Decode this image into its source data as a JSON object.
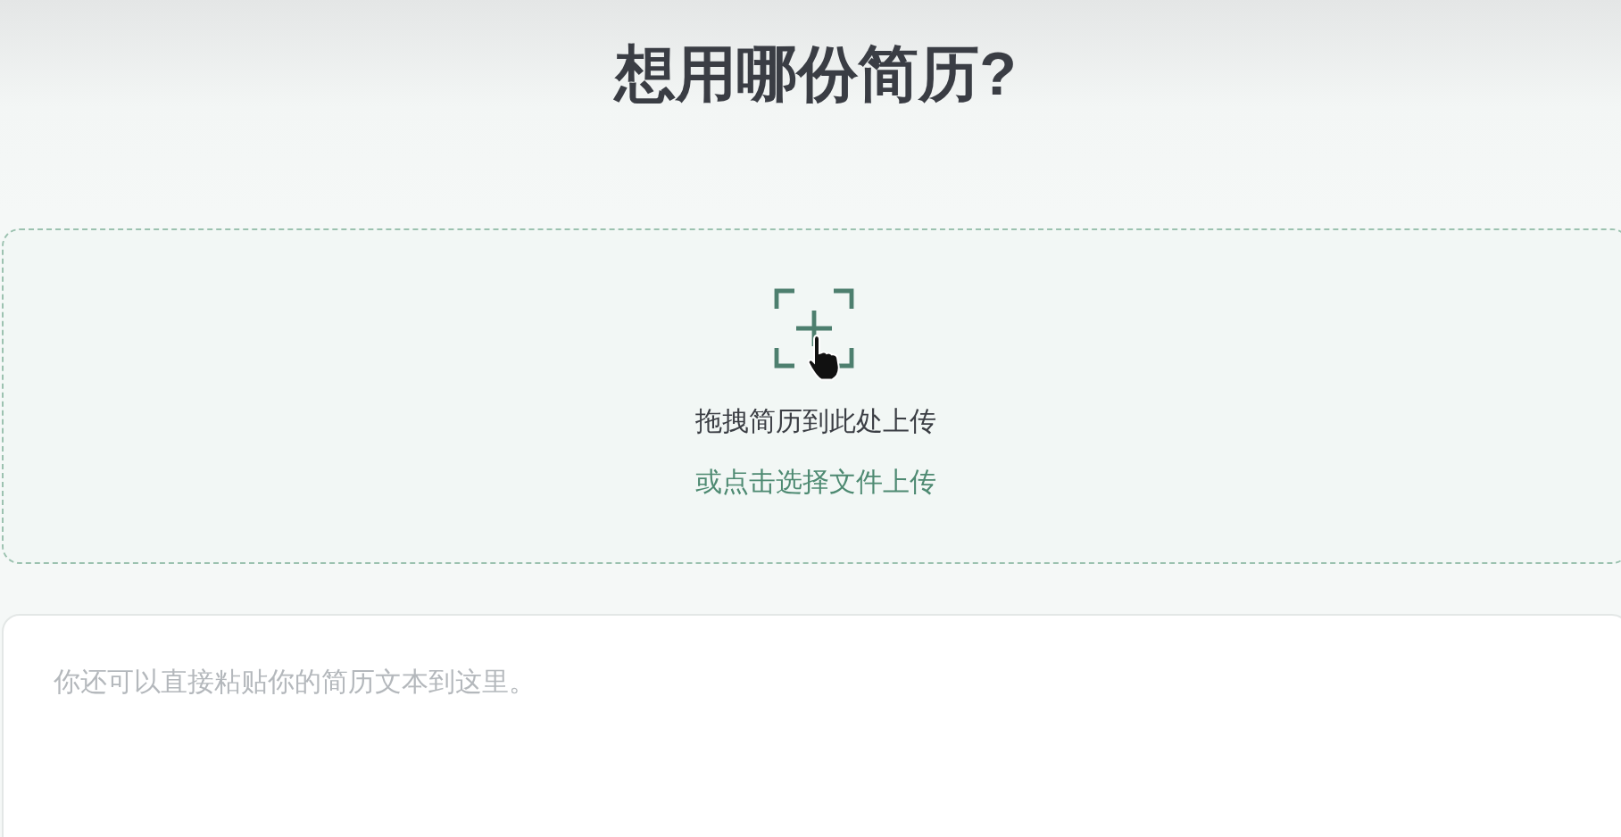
{
  "title": "想用哪份简历?",
  "upload": {
    "instruction": "拖拽简历到此处上传",
    "link": "或点击选择文件上传"
  },
  "paste_field": {
    "placeholder": "你还可以直接粘贴你的简历文本到这里。"
  }
}
